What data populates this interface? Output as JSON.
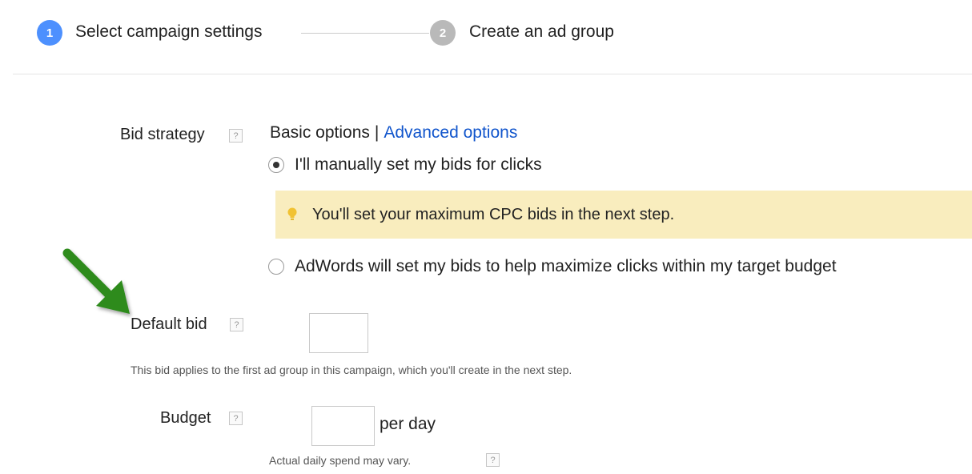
{
  "stepper": {
    "steps": [
      {
        "number": "1",
        "label": "Select campaign settings",
        "state": "active"
      },
      {
        "number": "2",
        "label": "Create an ad group",
        "state": "inactive"
      }
    ]
  },
  "bid_strategy": {
    "label": "Bid strategy",
    "help": "?",
    "basic_options": "Basic options",
    "separator": "|",
    "advanced_options": "Advanced options",
    "options": [
      {
        "label": "I'll manually set my bids for clicks",
        "selected": true
      },
      {
        "label": "AdWords will set my bids to help maximize clicks within my target budget",
        "selected": false
      }
    ],
    "notice": "You'll set your maximum CPC bids in the next step."
  },
  "default_bid": {
    "label": "Default bid",
    "help": "?",
    "value": "",
    "hint": "This bid applies to the first ad group in this campaign, which you'll create in the next step."
  },
  "budget": {
    "label": "Budget",
    "help": "?",
    "value": "",
    "unit": "per day",
    "hint": "Actual daily spend may vary.",
    "hint_help": "?"
  },
  "annotation": {
    "arrow_icon": "green-arrow-icon"
  },
  "colors": {
    "active_step": "#4d90fe",
    "inactive_step": "#b9b9b9",
    "link": "#1155cc",
    "notice_bg": "#f9edbe",
    "arrow": "#2e8b1e"
  }
}
